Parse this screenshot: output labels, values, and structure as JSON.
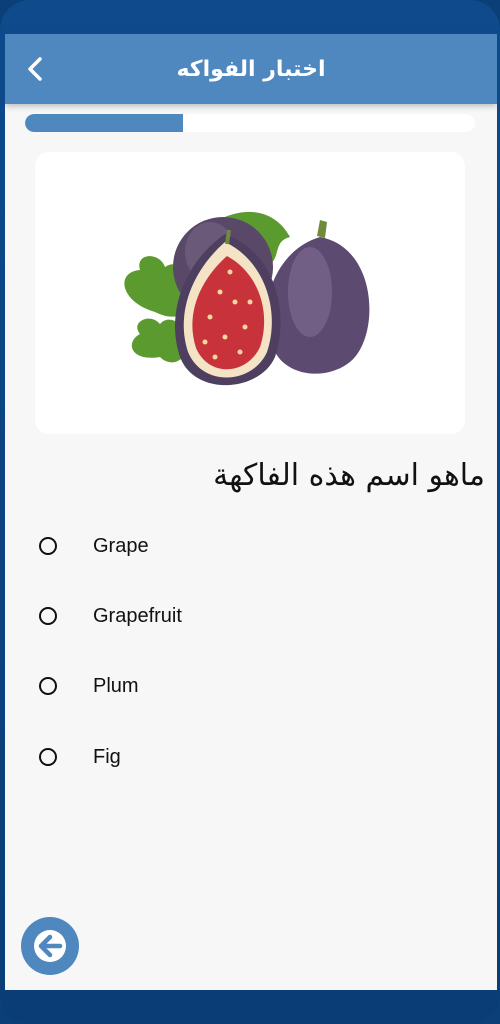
{
  "header": {
    "title": "اختبار الفواكه",
    "back_icon": "chevron-left-icon"
  },
  "progress": {
    "value": 0.35,
    "color": "#4f87bf"
  },
  "question": {
    "text": "ماهو اسم هذه الفاكهة"
  },
  "options": [
    {
      "label": "Grape",
      "selected": false
    },
    {
      "label": "Grapefruit",
      "selected": false
    },
    {
      "label": "Plum",
      "selected": false
    },
    {
      "label": "Fig",
      "selected": false
    }
  ],
  "fab": {
    "icon": "arrow-left-icon"
  },
  "colors": {
    "accent": "#4f87bf",
    "frame": "#0e4a8c",
    "background": "#f7f7f7"
  }
}
